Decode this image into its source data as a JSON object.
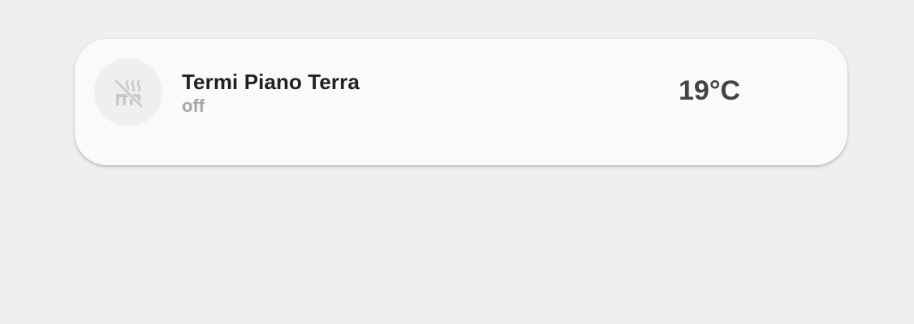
{
  "entity": {
    "name": "Termi Piano Terra",
    "state": "off",
    "temperature": "19°C",
    "icon": "radiator-off-icon"
  },
  "colors": {
    "background": "#efefef",
    "card": "#fafafa",
    "name_text": "#212121",
    "state_text": "#a6a6a6",
    "temperature_text": "#444444",
    "icon": "#c8c8c8"
  }
}
